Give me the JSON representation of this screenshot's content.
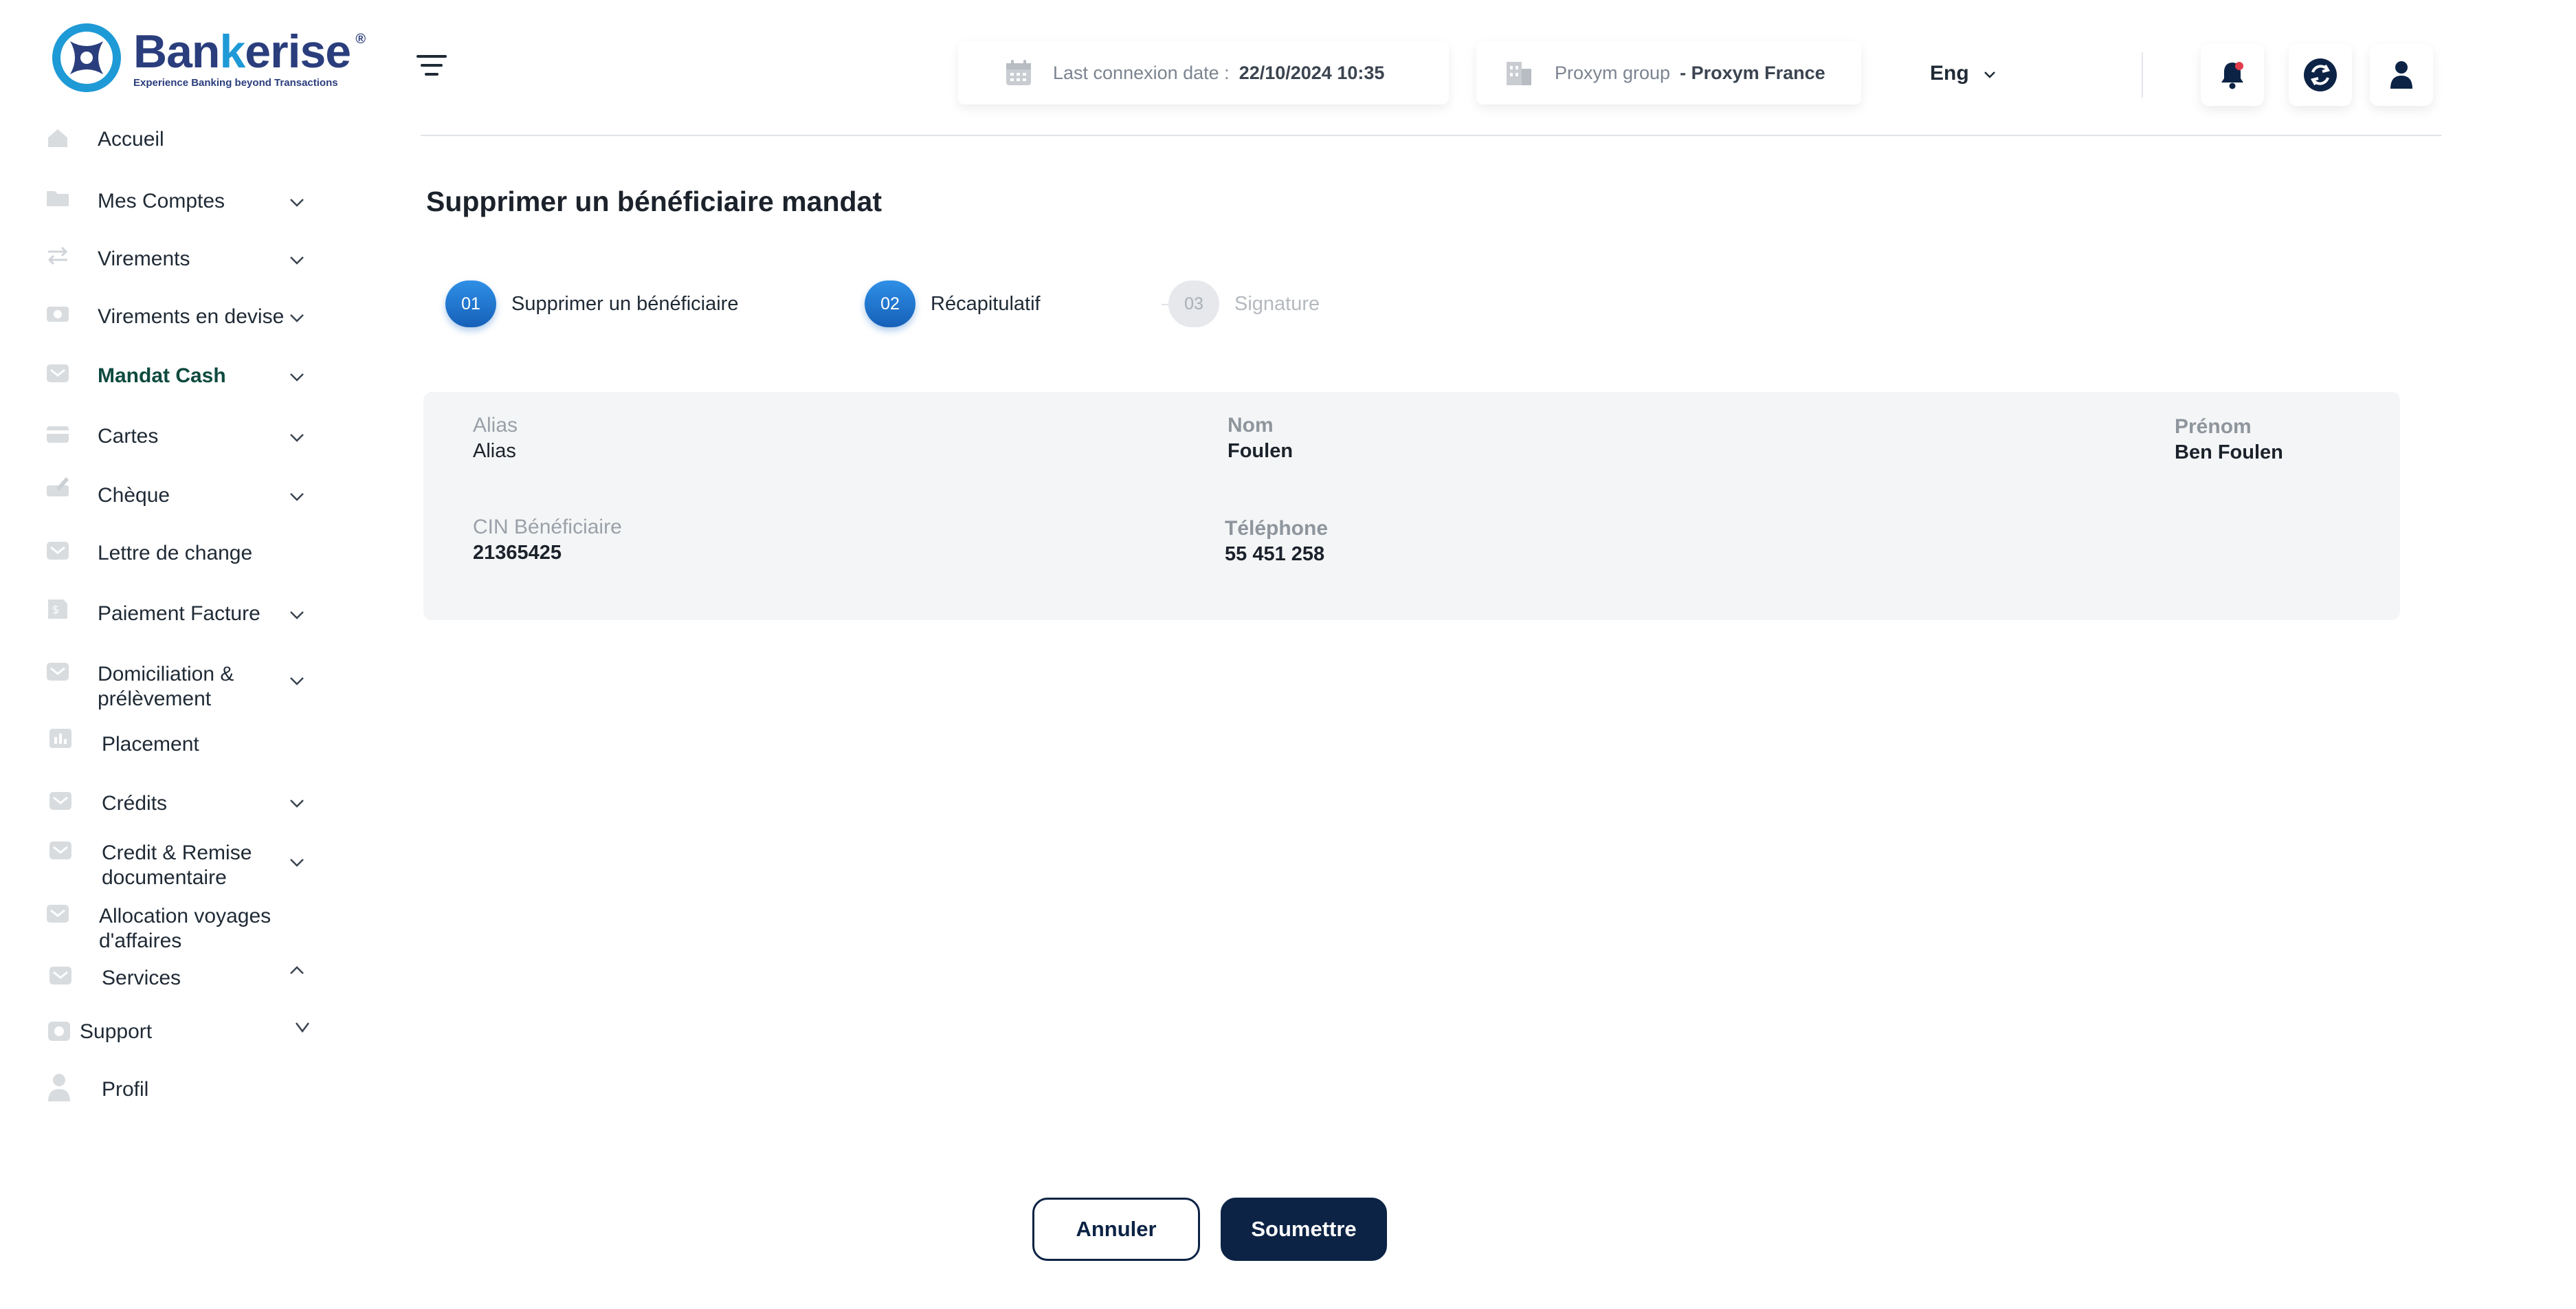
{
  "brand": {
    "name_part1": "Ban",
    "name_part2": "k",
    "name_part3": "erise",
    "tagline": "Experience Banking beyond Transactions",
    "registered": "®"
  },
  "sidebar": {
    "items": [
      {
        "label": "Accueil"
      },
      {
        "label": "Mes Comptes"
      },
      {
        "label": "Virements"
      },
      {
        "label": "Virements en devise"
      },
      {
        "label": "Mandat Cash"
      },
      {
        "label": "Cartes"
      },
      {
        "label": "Chèque"
      },
      {
        "label": "Lettre de change"
      },
      {
        "label": "Paiement Facture"
      },
      {
        "label": "Domiciliation &"
      },
      {
        "label": "prélèvement"
      },
      {
        "label": "Placement"
      },
      {
        "label": "Crédits"
      },
      {
        "label": "Credit & Remise"
      },
      {
        "label": "documentaire"
      },
      {
        "label": "Allocation  voyages"
      },
      {
        "label": "d'affaires"
      },
      {
        "label": "Services"
      },
      {
        "label": "Support"
      },
      {
        "label": "Profil"
      }
    ],
    "active": "Mandat Cash"
  },
  "header": {
    "last_connexion_label": "Last connexion date :",
    "last_connexion_value": "22/10/2024 10:35",
    "group_label": "Proxym group",
    "group_value": "- Proxym France",
    "language": "Eng"
  },
  "page": {
    "title": "Supprimer  un bénéficiaire mandat",
    "steps": [
      {
        "number": "01",
        "label": "Supprimer un bénéficiaire",
        "state": "done"
      },
      {
        "number": "02",
        "label": "Récapitulatif",
        "state": "done"
      },
      {
        "number": "03",
        "label": "Signature",
        "state": "todo"
      }
    ],
    "fields": {
      "alias": {
        "label": "Alias",
        "value": "Alias"
      },
      "nom": {
        "label": "Nom",
        "value": "Foulen"
      },
      "prenom": {
        "label": "Prénom",
        "value": "Ben Foulen"
      },
      "cin": {
        "label": "CIN Bénéficiaire",
        "value": "21365425"
      },
      "telephone": {
        "label": "Téléphone",
        "value": "55 451 258"
      }
    },
    "cancel_label": "Annuler",
    "submit_label": "Soumettre"
  },
  "colors": {
    "primary_dark": "#0c2345",
    "step_blue": "#1e78d2",
    "brand_blue": "#2a3d7c",
    "brand_cyan": "#1e9ad6",
    "active_nav": "#0e4a3f",
    "notification_dot": "#e23b4a"
  }
}
